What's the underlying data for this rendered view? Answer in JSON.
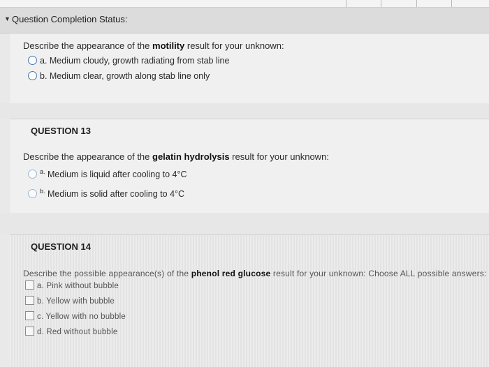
{
  "status": {
    "label": "Question Completion Status:"
  },
  "q12": {
    "prompt_pre": "Describe the appearance of the ",
    "prompt_bold": "motility",
    "prompt_post": " result for your unknown:",
    "options": [
      "a. Medium cloudy, growth radiating from stab line",
      "b. Medium clear, growth along stab line only"
    ]
  },
  "q13": {
    "header": "QUESTION 13",
    "prompt_pre": "Describe the appearance of the ",
    "prompt_bold": "gelatin hydrolysis",
    "prompt_post": " result for your unknown:",
    "options": [
      {
        "letter": "a.",
        "text": "Medium is liquid after cooling to 4°C"
      },
      {
        "letter": "b.",
        "text": "Medium is solid after cooling to 4°C"
      }
    ]
  },
  "q14": {
    "header": "QUESTION 14",
    "prompt_pre": "Describe the possible appearance(s) of the ",
    "prompt_bold": "phenol red glucose",
    "prompt_post": " result for your unknown: Choose ALL possible answers:",
    "options": [
      "a. Pink without bubble",
      "b. Yellow with bubble",
      "c. Yellow with no bubble",
      "d. Red without bubble"
    ]
  }
}
